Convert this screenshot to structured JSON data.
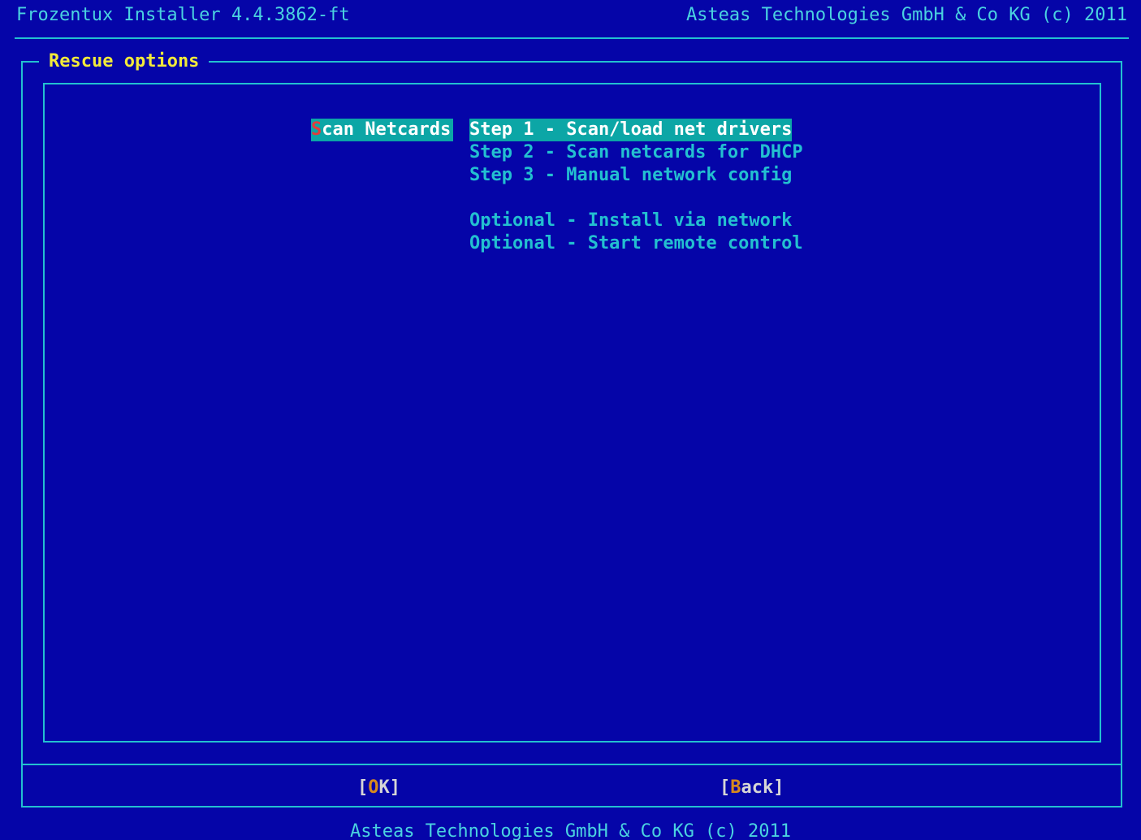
{
  "header": {
    "title": "Frozentux Installer 4.4.3862-ft",
    "copyright": "Asteas Technologies GmbH & Co KG (c) 2011"
  },
  "dialog": {
    "title": "Rescue options",
    "menu_label_hotkey": "S",
    "menu_label_rest": "can Netcards",
    "items": [
      {
        "label": "Step 1 - Scan/load net drivers",
        "selected": true
      },
      {
        "label": "Step 2 - Scan netcards for DHCP",
        "selected": false
      },
      {
        "label": "Step 3 - Manual network config",
        "selected": false
      },
      {
        "label": "Optional - Install via network",
        "selected": false
      },
      {
        "label": "Optional - Start remote control",
        "selected": false
      }
    ]
  },
  "buttons": {
    "ok": {
      "open": "[",
      "hotkey": "O",
      "rest": "K",
      "close": "]"
    },
    "back": {
      "open": "[",
      "hotkey": "B",
      "rest": "ack",
      "close": "]"
    }
  },
  "footer": {
    "text": "Asteas Technologies GmbH & Co KG (c) 2011"
  },
  "colors": {
    "background": "#0505a8",
    "frame": "#23c0d0",
    "title": "#f2ea3a",
    "selection": "#0ca6a6",
    "hotkey_red": "#e53a3a",
    "hotkey_button": "#d78a1e"
  }
}
